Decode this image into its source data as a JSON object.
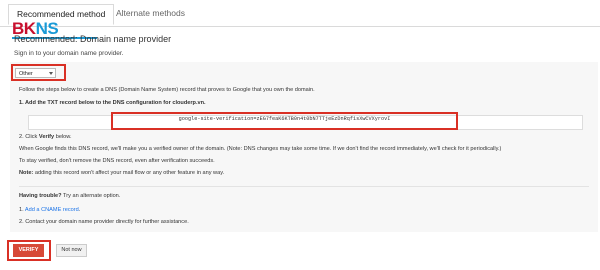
{
  "tabs": {
    "recommended": "Recommended method",
    "alternate": "Alternate methods"
  },
  "logo": {
    "part1": "BK",
    "part2": "NS"
  },
  "heading": "Recommended: Domain name provider",
  "signin": "Sign in to your domain name provider.",
  "provider_select": {
    "value": "Other"
  },
  "instructions": {
    "intro": "Follow the steps below to create a DNS (Domain Name System) record that proves to Google that you own the domain.",
    "step1_prefix": "1. Add the TXT record below to the DNS configuration for",
    "step1_domain": "clouderp.vn",
    "step1_suffix": ".",
    "txt_record": "google-site-verification=zEG7feaK6KTB0n4t0bN7TTjeEzDnRqf1sXwCVXyrovI",
    "step2_prefix": "2. Click",
    "step2_bold": "Verify",
    "step2_suffix": "below.",
    "when_found": "When Google finds this DNS record, we'll make you a verified owner of the domain. (Note: DNS changes may take some time. If we don't find the record immediately, we'll check for it periodically.)",
    "stay_verified": "To stay verified, don't remove the DNS record, even after verification succeeds.",
    "note_label": "Note:",
    "note_text": "adding this record won't affect your mail flow or any other feature in any way."
  },
  "trouble": {
    "label": "Having trouble?",
    "text": "Try an alternate option.",
    "option1_prefix": "1.",
    "option1_link": "Add a CNAME record",
    "option1_suffix": ".",
    "option2": "2. Contact your domain name provider directly for further assistance."
  },
  "buttons": {
    "verify": "VERIFY",
    "not_now": "Not now"
  },
  "colors": {
    "highlight": "#d93025",
    "verify_bg": "#d74937",
    "link": "#1a73e8"
  }
}
